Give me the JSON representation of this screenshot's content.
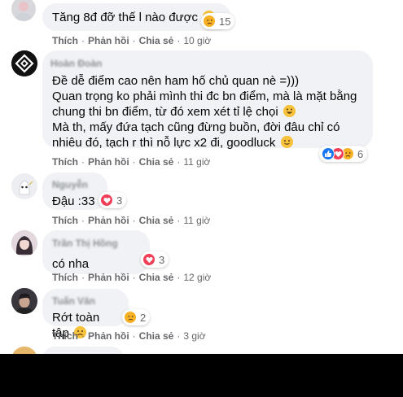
{
  "comments": [
    {
      "text": "Tăng 8đ đỡ thế l nào được",
      "reaction": {
        "icons": [
          "sad-icon"
        ],
        "count": "15"
      },
      "actions": {
        "like": "Thích",
        "reply": "Phản hồi",
        "share": "Chia sẻ",
        "time": "10 giờ"
      }
    },
    {
      "author": "Hoàn Đoàn",
      "lines": [
        "Đề dễ điểm cao nên ham hố chủ quan nè =)))",
        "Quan trọng ko phải mình thi đc bn điểm, mà là mặt bằng",
        "chung thi bn điểm, từ đó xem xét tỉ lệ chọi",
        "Mà th, mấy đứa tạch cũng đừng buồn, đời đâu chỉ có",
        "nhiêu đó, tạch r thì nỗ lực x2 đi, goodluck"
      ],
      "reaction": {
        "icons": [
          "like-icon",
          "love-icon",
          "sad-icon"
        ],
        "count": "6"
      },
      "actions": {
        "like": "Thích",
        "reply": "Phản hồi",
        "share": "Chia sẻ",
        "time": "11 giờ"
      }
    },
    {
      "author": "Nguyễn",
      "text": "Đậu :33",
      "reaction": {
        "icons": [
          "love-icon"
        ],
        "count": "3"
      },
      "actions": {
        "like": "Thích",
        "reply": "Phản hồi",
        "share": "Chia sẻ",
        "time": "11 giờ"
      }
    },
    {
      "author": "Trần Thị Hồng",
      "text": "có nha",
      "reaction": {
        "icons": [
          "love-icon"
        ],
        "count": "3"
      },
      "actions": {
        "like": "Thích",
        "reply": "Phản hồi",
        "share": "Chia sẻ",
        "time": "12 giờ"
      }
    },
    {
      "author": "Tuấn Văn",
      "text": "Rớt toàn tập",
      "reaction": {
        "icons": [
          "sad-icon"
        ],
        "count": "2"
      },
      "actions": {
        "like": "Thích",
        "reply": "Phản hồi",
        "share": "Chia sẻ",
        "time": "3 giờ"
      }
    }
  ],
  "colors": {
    "like": "#1877f2",
    "love": "#f33e58",
    "sad": "#f7b125",
    "bubble": "#f0f2f5"
  }
}
